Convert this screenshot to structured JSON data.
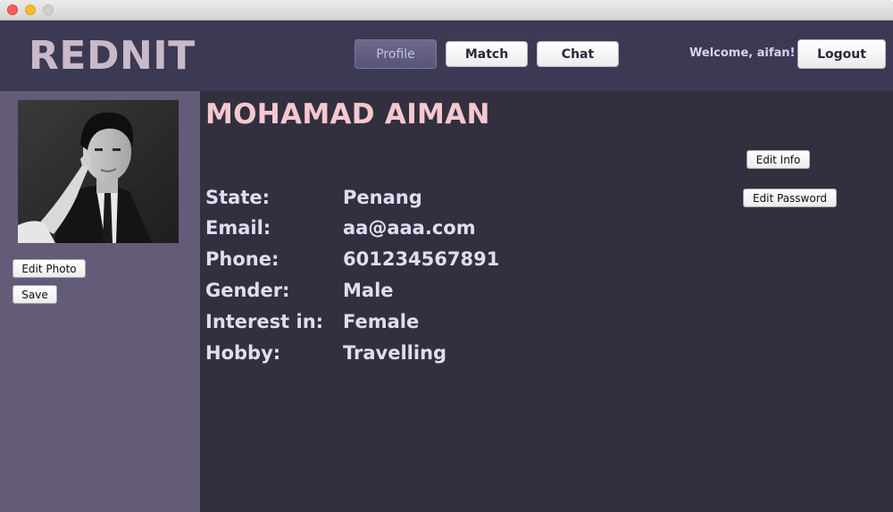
{
  "window": {
    "title": ""
  },
  "header": {
    "logo": "REDNIT",
    "nav": [
      {
        "label": "Profile",
        "active": true
      },
      {
        "label": "Match",
        "active": false
      },
      {
        "label": "Chat",
        "active": false
      }
    ],
    "welcome": "Welcome, aifan!",
    "logout_label": "Logout"
  },
  "sidebar": {
    "photo_alt": "profile photo",
    "edit_photo_label": "Edit Photo",
    "save_label": "Save"
  },
  "profile": {
    "name": "MOHAMAD AIMAN",
    "edit_info_label": "Edit Info",
    "edit_password_label": "Edit Password",
    "fields": [
      {
        "label": "State:",
        "value": "Penang"
      },
      {
        "label": "Email:",
        "value": "aa@aaa.com"
      },
      {
        "label": "Phone:",
        "value": "601234567891"
      },
      {
        "label": "Gender:",
        "value": "Male"
      },
      {
        "label": "Interest in:",
        "value": "Female"
      },
      {
        "label": "Hobby:",
        "value": "Travelling"
      }
    ]
  },
  "colors": {
    "header_bg": "#3b3953",
    "sidebar_bg": "#635b78",
    "main_bg": "#32303e",
    "name_color": "#f5c8d0",
    "text_color": "#e2dbf4"
  }
}
